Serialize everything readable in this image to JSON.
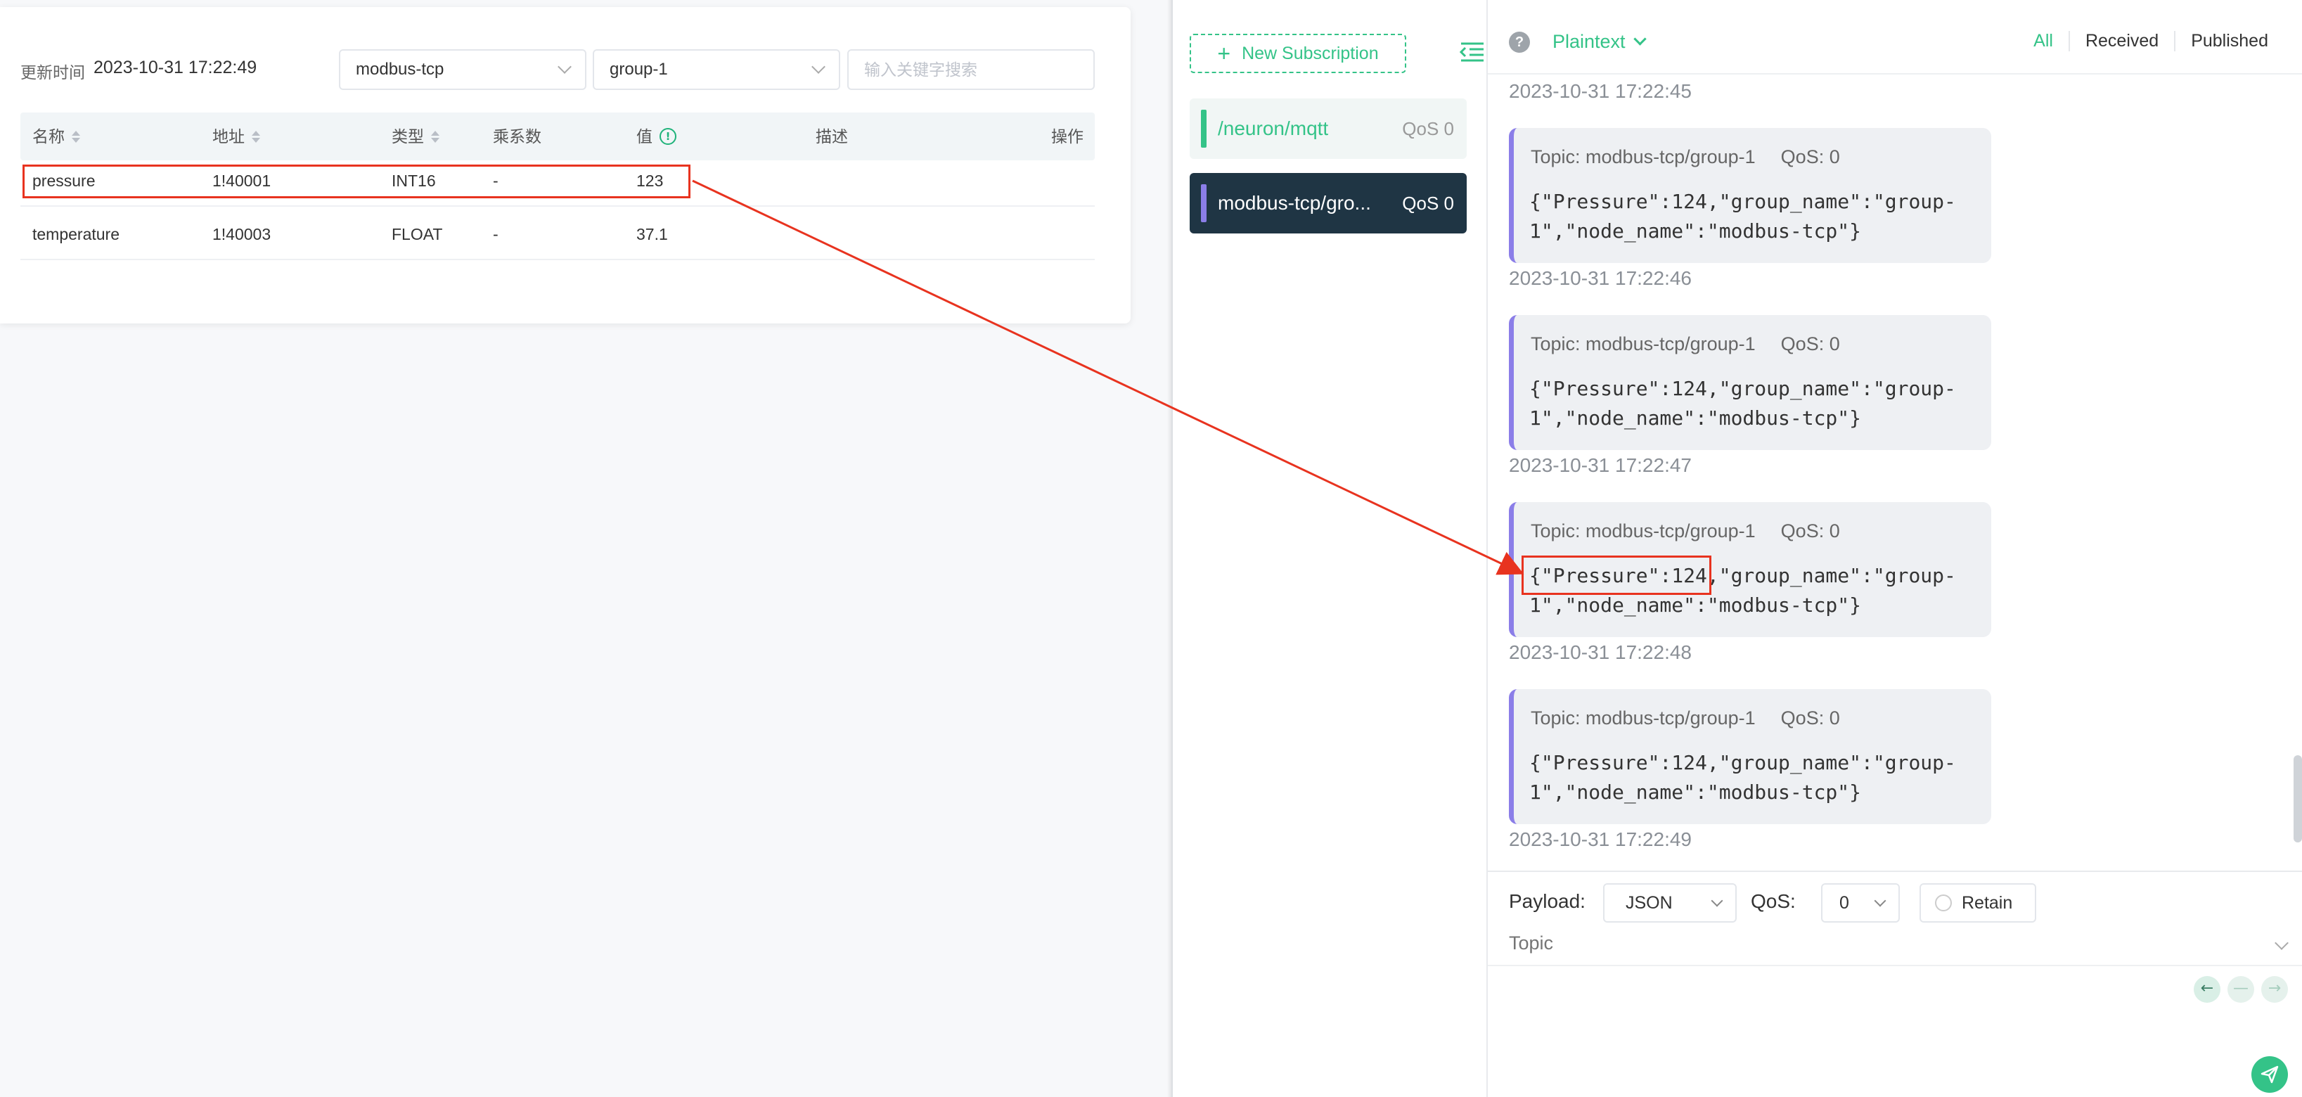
{
  "neuron": {
    "update_label": "更新时间",
    "update_time": "2023-10-31 17:22:49",
    "device_select": "modbus-tcp",
    "group_select": "group-1",
    "search_placeholder": "输入关键字搜索",
    "columns": [
      "名称",
      "地址",
      "类型",
      "乘系数",
      "值",
      "描述",
      "操作"
    ],
    "rows": [
      {
        "name": "pressure",
        "address": "1!40001",
        "type": "INT16",
        "multiplier": "-",
        "value": "123"
      },
      {
        "name": "temperature",
        "address": "1!40003",
        "type": "FLOAT",
        "multiplier": "-",
        "value": "37.1"
      }
    ]
  },
  "mqttx": {
    "new_subscription": "New Subscription",
    "subscriptions": [
      {
        "topic": "/neuron/mqtt",
        "qos": "QoS 0",
        "color": "#34c388"
      },
      {
        "topic": "modbus-tcp/gro...",
        "qos": "QoS 0",
        "color": "#8b7ee8"
      }
    ],
    "format": "Plaintext",
    "filters": [
      "All",
      "Received",
      "Published"
    ],
    "top_timestamp": "2023-10-31 17:22:45",
    "messages": [
      {
        "topic": "Topic: modbus-tcp/group-1",
        "qos": "QoS: 0",
        "payload": "{\"Pressure\":124,\"group_name\":\"group-1\",\"node_name\":\"modbus-tcp\"}",
        "time": "2023-10-31 17:22:46"
      },
      {
        "topic": "Topic: modbus-tcp/group-1",
        "qos": "QoS: 0",
        "payload": "{\"Pressure\":124,\"group_name\":\"group-1\",\"node_name\":\"modbus-tcp\"}",
        "time": "2023-10-31 17:22:47"
      },
      {
        "topic": "Topic: modbus-tcp/group-1",
        "qos": "QoS: 0",
        "payload": "{\"Pressure\":124,\"group_name\":\"group-1\",\"node_name\":\"modbus-tcp\"}",
        "time": "2023-10-31 17:22:48"
      },
      {
        "topic": "Topic: modbus-tcp/group-1",
        "qos": "QoS: 0",
        "payload": "{\"Pressure\":124,\"group_name\":\"group-1\",\"node_name\":\"modbus-tcp\"}",
        "time": "2023-10-31 17:22:49"
      }
    ],
    "composer": {
      "payload_label": "Payload:",
      "payload_format": "JSON",
      "qos_label": "QoS:",
      "qos_value": "0",
      "retain_label": "Retain",
      "topic_placeholder": "Topic"
    }
  },
  "colors": {
    "accent_green": "#34c388",
    "highlight_red": "#e8331f",
    "subscription_purple": "#8b7ee8",
    "dark_sidebar_item": "#1f3544"
  }
}
